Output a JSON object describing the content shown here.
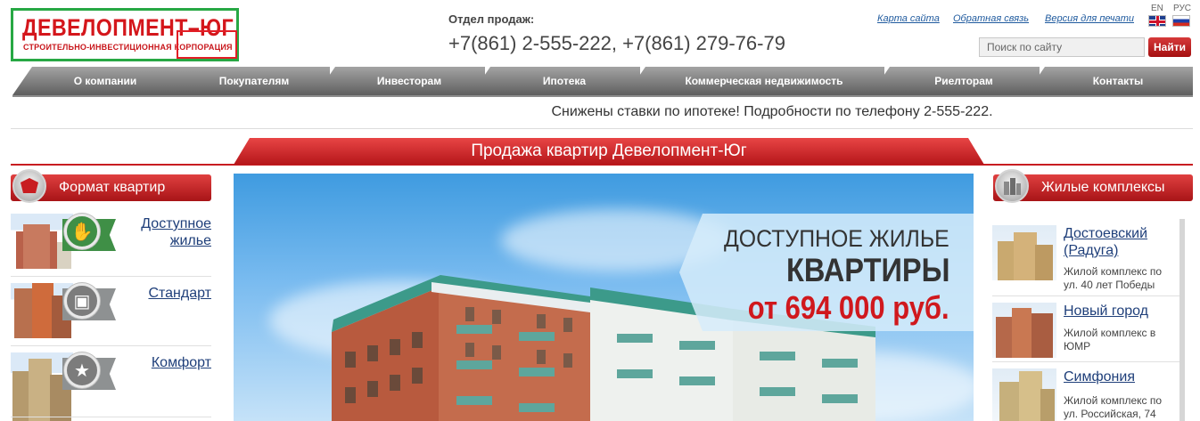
{
  "logo": {
    "title": "ДЕВЕЛОПМЕНТ–ЮГ",
    "subtitle": "СТРОИТЕЛЬНО-ИНВЕСТИЦИОННАЯ КОРПОРАЦИЯ"
  },
  "sales": {
    "label": "Отдел продаж:",
    "phones": "+7(861) 2-555-222, +7(861) 279-76-79"
  },
  "top_links": [
    "Карта сайта",
    "Обратная связь",
    "Версия для печати"
  ],
  "languages": [
    "EN",
    "РУС"
  ],
  "search": {
    "placeholder": "Поиск по сайту",
    "button": "Найти"
  },
  "nav": [
    "О компании",
    "Покупателям",
    "Инвесторам",
    "Ипотека",
    "Коммерческая недвижимость",
    "Риелторам",
    "Контакты"
  ],
  "promo": "Снижены ставки по ипотеке! Подробности по телефону 2-555-222.",
  "main_title": "Продажа квартир Девелопмент-Юг",
  "left": {
    "title": "Формат квартир",
    "items": [
      {
        "label_line1": "Доступное",
        "label_line2": "жилье",
        "icon": "thumbs-up-icon"
      },
      {
        "label_line1": "Стандарт",
        "label_line2": "",
        "icon": "briefcase-icon"
      },
      {
        "label_line1": "Комфорт",
        "label_line2": "",
        "icon": "star-icon"
      }
    ]
  },
  "banner": {
    "line1": "ДОСТУПНОЕ ЖИЛЬЕ",
    "line2": "КВАРТИРЫ",
    "line3": "от 694 000 руб."
  },
  "right": {
    "title": "Жилые комплексы",
    "items": [
      {
        "name_line1": "Достоевский",
        "name_line2": "(Радуга)",
        "desc_line1": "Жилой комплекс по",
        "desc_line2": "ул. 40 лет Победы"
      },
      {
        "name_line1": "Новый город",
        "name_line2": "",
        "desc_line1": "Жилой комплекс в",
        "desc_line2": "ЮМР"
      },
      {
        "name_line1": "Симфония",
        "name_line2": "",
        "desc_line1": "Жилой комплекс по",
        "desc_line2": "ул. Российская, 74"
      }
    ]
  },
  "colors": {
    "accent_red": "#c81d21",
    "nav_gray": "#7a7a7a",
    "link_blue": "#1f3f7a",
    "logo_frame_green": "#27a844"
  }
}
